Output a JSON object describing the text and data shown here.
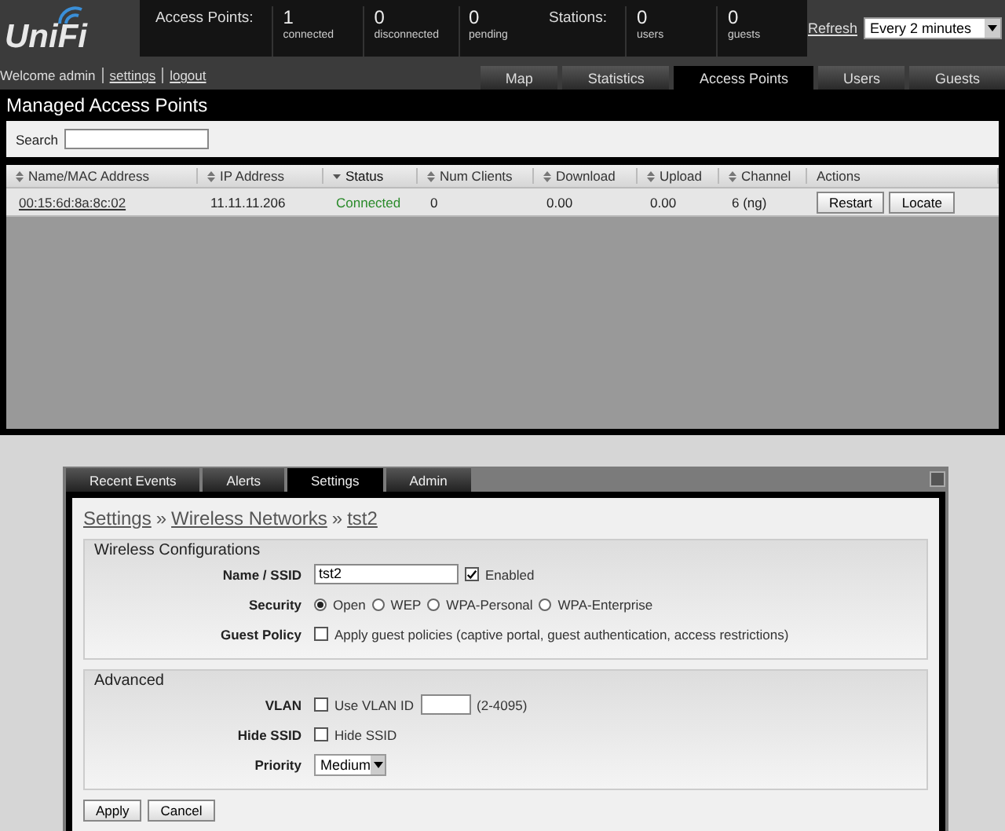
{
  "header": {
    "logo": "UniFi",
    "stats": [
      {
        "label": "Access Points:",
        "items": [
          {
            "value": "1",
            "caption": "connected"
          },
          {
            "value": "0",
            "caption": "disconnected"
          },
          {
            "value": "0",
            "caption": "pending"
          }
        ]
      },
      {
        "label": "Stations:",
        "items": [
          {
            "value": "0",
            "caption": "users"
          },
          {
            "value": "0",
            "caption": "guests"
          }
        ]
      }
    ],
    "refresh": {
      "link": "Refresh",
      "value": "Every 2 minutes"
    },
    "welcome": "Welcome admin",
    "links": [
      "settings",
      "logout"
    ],
    "tabs": [
      {
        "label": "Map",
        "selected": false
      },
      {
        "label": "Statistics",
        "selected": false
      },
      {
        "label": "Access Points",
        "selected": true
      },
      {
        "label": "Users",
        "selected": false
      },
      {
        "label": "Guests",
        "selected": false
      }
    ]
  },
  "panel": {
    "title": "Managed Access Points",
    "search": {
      "label": "Search"
    },
    "table": {
      "columns": [
        {
          "label": "Name/MAC Address",
          "sortable": true,
          "sorted": false
        },
        {
          "label": "IP Address",
          "sortable": true,
          "sorted": false
        },
        {
          "label": "Status",
          "sortable": true,
          "sorted": true
        },
        {
          "label": "Num Clients",
          "sortable": true,
          "sorted": false
        },
        {
          "label": "Download",
          "sortable": true,
          "sorted": false
        },
        {
          "label": "Upload",
          "sortable": true,
          "sorted": false
        },
        {
          "label": "Channel",
          "sortable": true,
          "sorted": false
        },
        {
          "label": "Actions",
          "sortable": false,
          "sorted": false
        }
      ],
      "rows": [
        {
          "mac": "00:15:6d:8a:8c:02",
          "ip": "11.11.11.206",
          "status": "Connected",
          "clients": "0",
          "download": "0.00",
          "upload": "0.00",
          "channel": "6 (ng)",
          "actions": [
            "Restart",
            "Locate"
          ]
        }
      ]
    }
  },
  "bottom": {
    "tabs": [
      {
        "label": "Recent Events",
        "selected": false
      },
      {
        "label": "Alerts",
        "selected": false
      },
      {
        "label": "Settings",
        "selected": true
      },
      {
        "label": "Admin",
        "selected": false
      }
    ],
    "breadcrumb": [
      "Settings",
      "Wireless Networks",
      "tst2"
    ],
    "separator": "»",
    "sections": [
      {
        "title": "Wireless Configurations",
        "fields": [
          {
            "kind": "text",
            "label": "Name / SSID",
            "value": "tst2",
            "check": {
              "label": "Enabled",
              "checked": true
            }
          },
          {
            "kind": "radio",
            "label": "Security",
            "options": [
              {
                "label": "Open",
                "selected": true
              },
              {
                "label": "WEP",
                "selected": false
              },
              {
                "label": "WPA-Personal",
                "selected": false
              },
              {
                "label": "WPA-Enterprise",
                "selected": false
              }
            ]
          },
          {
            "kind": "checkbox",
            "label": "Guest Policy",
            "check": {
              "label": "Apply guest policies (captive portal, guest authentication, access restrictions)",
              "checked": false
            }
          }
        ]
      },
      {
        "title": "Advanced",
        "fields": [
          {
            "kind": "checkinput",
            "label": "VLAN",
            "check": {
              "label": "Use VLAN ID",
              "checked": false
            },
            "hint": "(2-4095)"
          },
          {
            "kind": "checkbox",
            "label": "Hide SSID",
            "check": {
              "label": "Hide SSID",
              "checked": false
            }
          },
          {
            "kind": "select",
            "label": "Priority",
            "value": "Medium"
          }
        ]
      }
    ],
    "buttons": [
      "Apply",
      "Cancel"
    ]
  }
}
